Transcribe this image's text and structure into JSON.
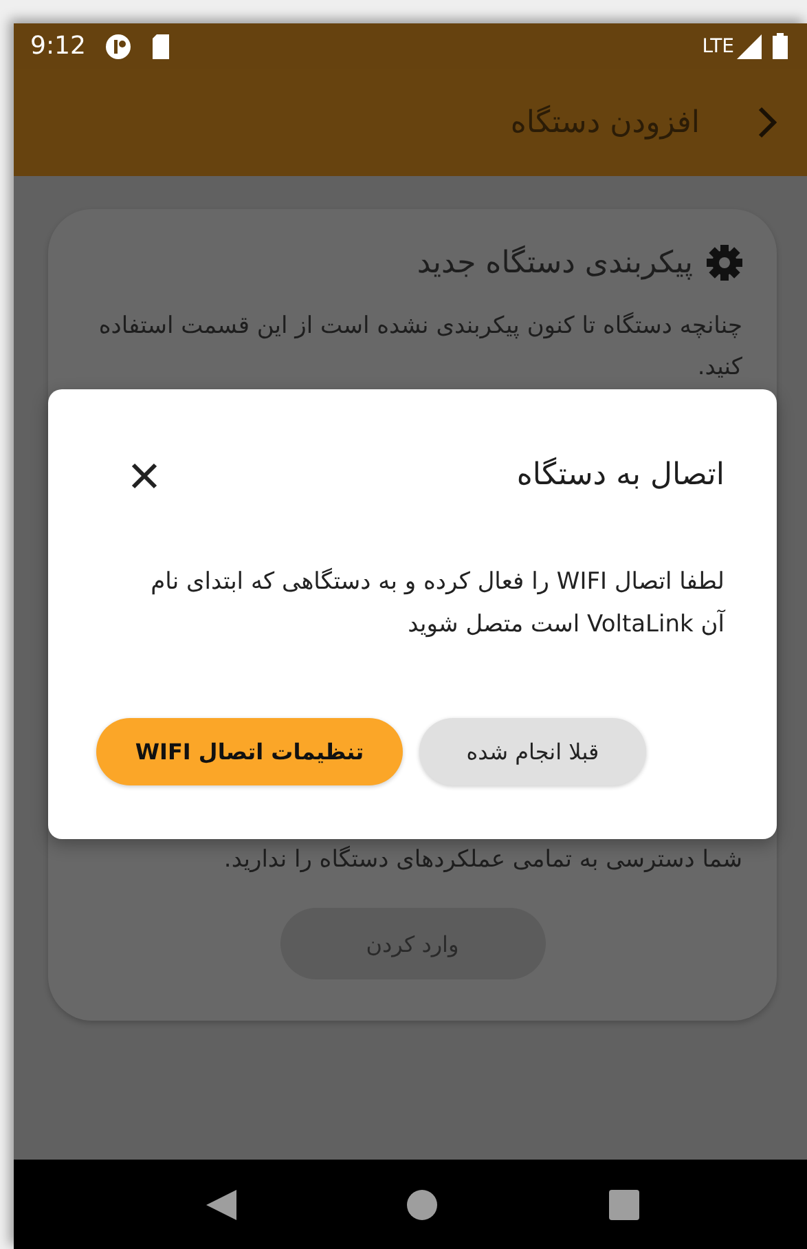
{
  "status_bar": {
    "time": "9:12",
    "network": "LTE"
  },
  "app_bar": {
    "title": "افزودن دستگاه"
  },
  "card": {
    "title": "پیکربندی دستگاه جدید",
    "description": "چنانچه دستگاه تا کنون پیکربندی نشده است از این قسمت استفاده کنید.",
    "note": "شما دسترسی به تمامی عملکردهای دستگاه را ندارید.",
    "button": "وارد کردن"
  },
  "dialog": {
    "title": "اتصال به دستگاه",
    "message": "لطفا اتصال WIFI را فعال کرده و به دستگاهی که ابتدای نام آن VoltaLink است متصل شوید",
    "buttons": [
      {
        "label": "قبلا انجام شده",
        "kind": "secondary"
      },
      {
        "label": "تنظیمات اتصال WIFI",
        "kind": "primary"
      }
    ]
  }
}
